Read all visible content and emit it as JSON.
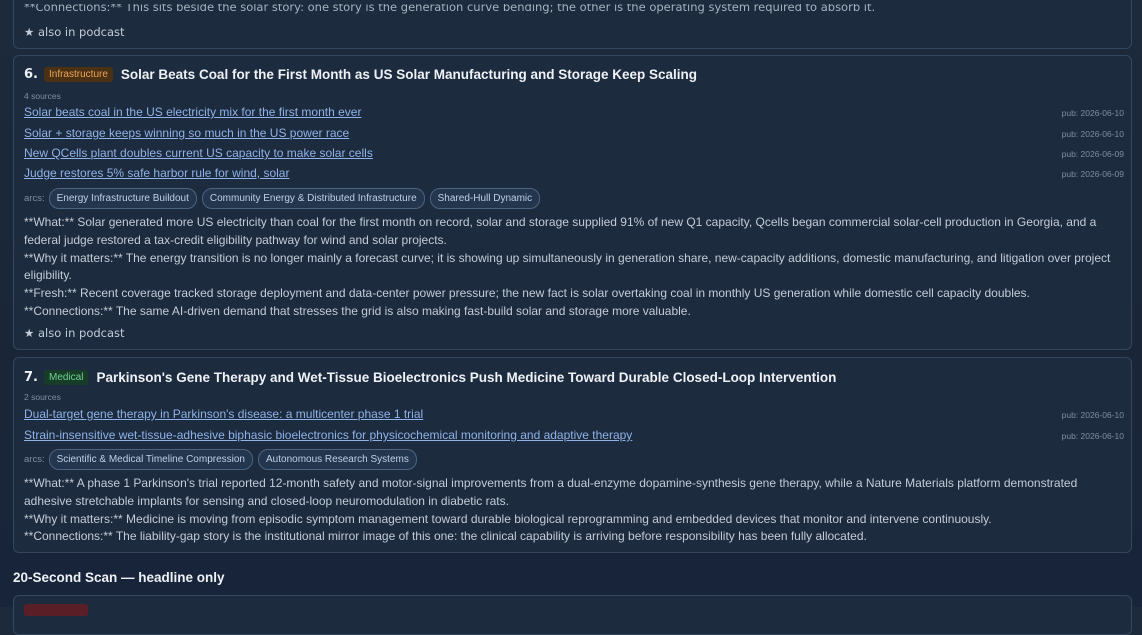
{
  "top_card": {
    "connections_text": "**Connections:** This sits beside the solar story: one story is the generation curve bending; the other is the operating system required to absorb it.",
    "also_in_podcast": "★ also in podcast"
  },
  "story6": {
    "number": "6.",
    "category": "Infrastructure",
    "title": "Solar Beats Coal for the First Month as US Solar Manufacturing and Storage Keep Scaling",
    "sources_count": "4 sources",
    "sources": [
      {
        "title": "Solar beats coal in the US electricity mix for the first month ever",
        "date": "pub: 2026-06-10"
      },
      {
        "title": "Solar + storage keeps winning so much in the US power race",
        "date": "pub: 2026-06-10"
      },
      {
        "title": "New QCells plant doubles current US capacity to make solar cells",
        "date": "pub: 2026-06-09"
      },
      {
        "title": "Judge restores 5% safe harbor rule for wind, solar",
        "date": "pub: 2026-06-09"
      }
    ],
    "arcs_label": "arcs:",
    "arcs": [
      "Energy Infrastructure Buildout",
      "Community Energy & Distributed Infrastructure",
      "Shared-Hull Dynamic"
    ],
    "what": "**What:** Solar generated more US electricity than coal for the first month on record, solar and storage supplied 91% of new Q1 capacity, Qcells began commercial solar-cell production in Georgia, and a federal judge restored a tax-credit eligibility pathway for wind and solar projects.",
    "why": "**Why it matters:** The energy transition is no longer mainly a forecast curve; it is showing up simultaneously in generation share, new-capacity additions, domestic manufacturing, and litigation over project eligibility.",
    "fresh": "**Fresh:** Recent coverage tracked storage deployment and data-center power pressure; the new fact is solar overtaking coal in monthly US generation while domestic cell capacity doubles.",
    "connections": "**Connections:** The same AI-driven demand that stresses the grid is also making fast-build solar and storage more valuable.",
    "also_in_podcast": "★ also in podcast"
  },
  "story7": {
    "number": "7.",
    "category": "Medical",
    "title": "Parkinson's Gene Therapy and Wet-Tissue Bioelectronics Push Medicine Toward Durable Closed-Loop Intervention",
    "sources_count": "2 sources",
    "sources": [
      {
        "title": "Dual-target gene therapy in Parkinson's disease: a multicenter phase 1 trial",
        "date": "pub: 2026-06-10"
      },
      {
        "title": "Strain-insensitive wet-tissue-adhesive biphasic bioelectronics for physicochemical monitoring and adaptive therapy",
        "date": "pub: 2026-06-10"
      }
    ],
    "arcs_label": "arcs:",
    "arcs": [
      "Scientific & Medical Timeline Compression",
      "Autonomous Research Systems"
    ],
    "what": "**What:** A phase 1 Parkinson's trial reported 12-month safety and motor-signal improvements from a dual-enzyme dopamine-synthesis gene therapy, while a Nature Materials platform demonstrated adhesive stretchable implants for sensing and closed-loop neuromodulation in diabetic rats.",
    "why": "**Why it matters:** Medicine is moving from episodic symptom management toward durable biological reprogramming and embedded devices that monitor and intervene continuously.",
    "connections": "**Connections:** The liability-gap story is the institutional mirror image of this one: the clinical capability is arriving before responsibility has been fully allocated."
  },
  "scan_section": {
    "heading": "20-Second Scan — headline only"
  },
  "colors": {
    "background": "#1a2638",
    "card": "#1d2b3e",
    "link": "#8fb2e8",
    "infrastructure_badge": "#eaa45a",
    "medical_badge": "#6fd28f"
  }
}
